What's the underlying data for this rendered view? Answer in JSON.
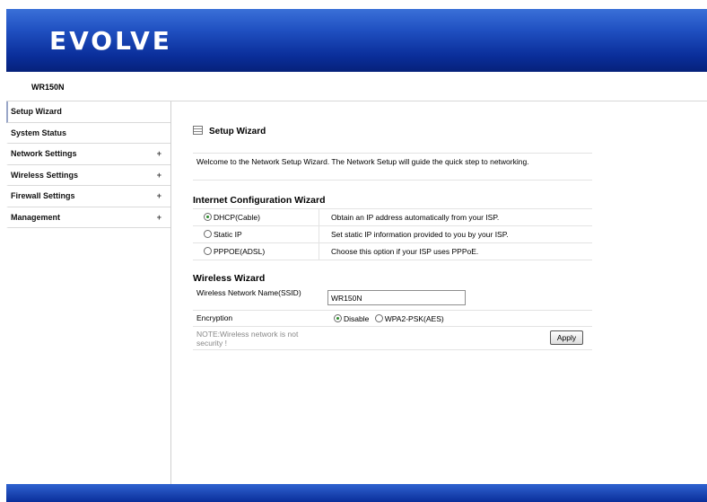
{
  "header": {
    "logo_text": "EVOLVE",
    "model": "WR150N"
  },
  "sidebar": {
    "items": [
      {
        "label": "Setup Wizard",
        "expandable": false
      },
      {
        "label": "System Status",
        "expandable": false
      },
      {
        "label": "Network Settings",
        "expandable": true,
        "plus": "+"
      },
      {
        "label": "Wireless Settings",
        "expandable": true,
        "plus": "+"
      },
      {
        "label": "Firewall Settings",
        "expandable": true,
        "plus": "+"
      },
      {
        "label": "Management",
        "expandable": true,
        "plus": "+"
      }
    ]
  },
  "main": {
    "title": "Setup Wizard",
    "welcome": "Welcome to the Network Setup Wizard. The Network Setup will guide the quick step to networking.",
    "internet": {
      "title": "Internet Configuration Wizard",
      "options": [
        {
          "label": "DHCP(Cable)",
          "desc": "Obtain an IP address automatically from your ISP.",
          "selected": true
        },
        {
          "label": "Static IP",
          "desc": "Set static IP information provided to you by your ISP.",
          "selected": false
        },
        {
          "label": "PPPOE(ADSL)",
          "desc": "Choose this option if your ISP uses PPPoE.",
          "selected": false
        }
      ]
    },
    "wireless": {
      "title": "Wireless Wizard",
      "ssid_label": "Wireless Network Name(SSID)",
      "ssid_value": "WR150N",
      "encryption_label": "Encryption",
      "enc_disable": "Disable",
      "enc_wpa2": "WPA2-PSK(AES)",
      "encryption_selected": "Disable",
      "note": "NOTE:Wireless network is not security !",
      "apply_label": "Apply"
    }
  }
}
